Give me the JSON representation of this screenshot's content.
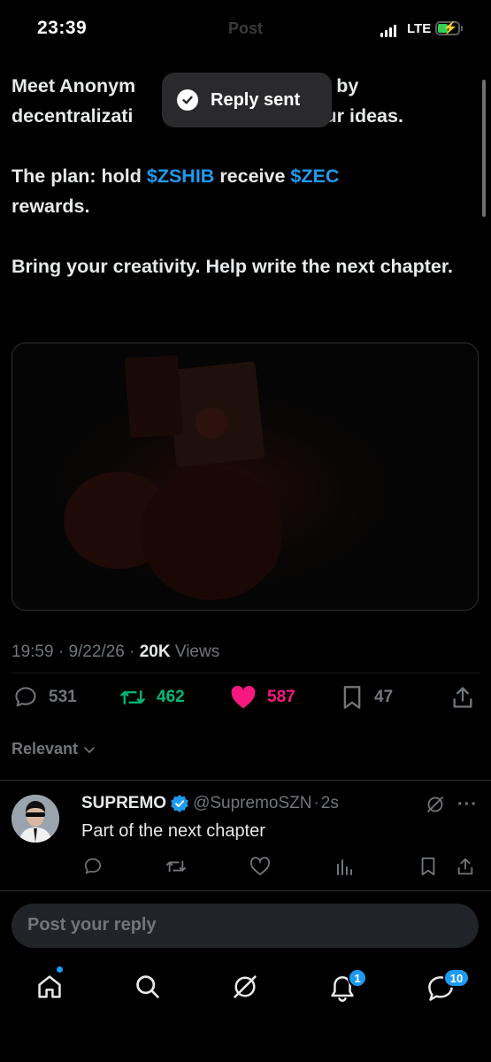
{
  "status_bar": {
    "time": "23:39",
    "header_title": "Post",
    "network": "LTE"
  },
  "toast": {
    "label": "Reply sent"
  },
  "post": {
    "line1": "Meet Anonym",
    "line1_end": "ed by",
    "line2": "decentralizati",
    "line2_end": "your ideas.",
    "plan_prefix": "The plan: hold ",
    "cashtag1": "$ZSHIB",
    "plan_mid": " receive ",
    "cashtag2": "$ZEC",
    "plan_end": "rewards.",
    "para3": "Bring your creativity. Help write the next chapter."
  },
  "meta": {
    "time": "19:59",
    "date": "9/22/26",
    "views_count": "20K",
    "views_label": "Views"
  },
  "actions": {
    "replies": "531",
    "reposts": "462",
    "likes": "587",
    "bookmarks": "47"
  },
  "sort": {
    "label": "Relevant"
  },
  "reply": {
    "name": "SUPREMO",
    "handle": "@SupremoSZN",
    "age": "2s",
    "text": "Part of the next chapter"
  },
  "composer": {
    "placeholder": "Post your reply"
  },
  "nav": {
    "notifications_badge": "1",
    "messages_badge": "10"
  },
  "colors": {
    "accent": "#1d9bf0",
    "repost": "#00ba7c",
    "like": "#f91880",
    "background": "#000000"
  }
}
